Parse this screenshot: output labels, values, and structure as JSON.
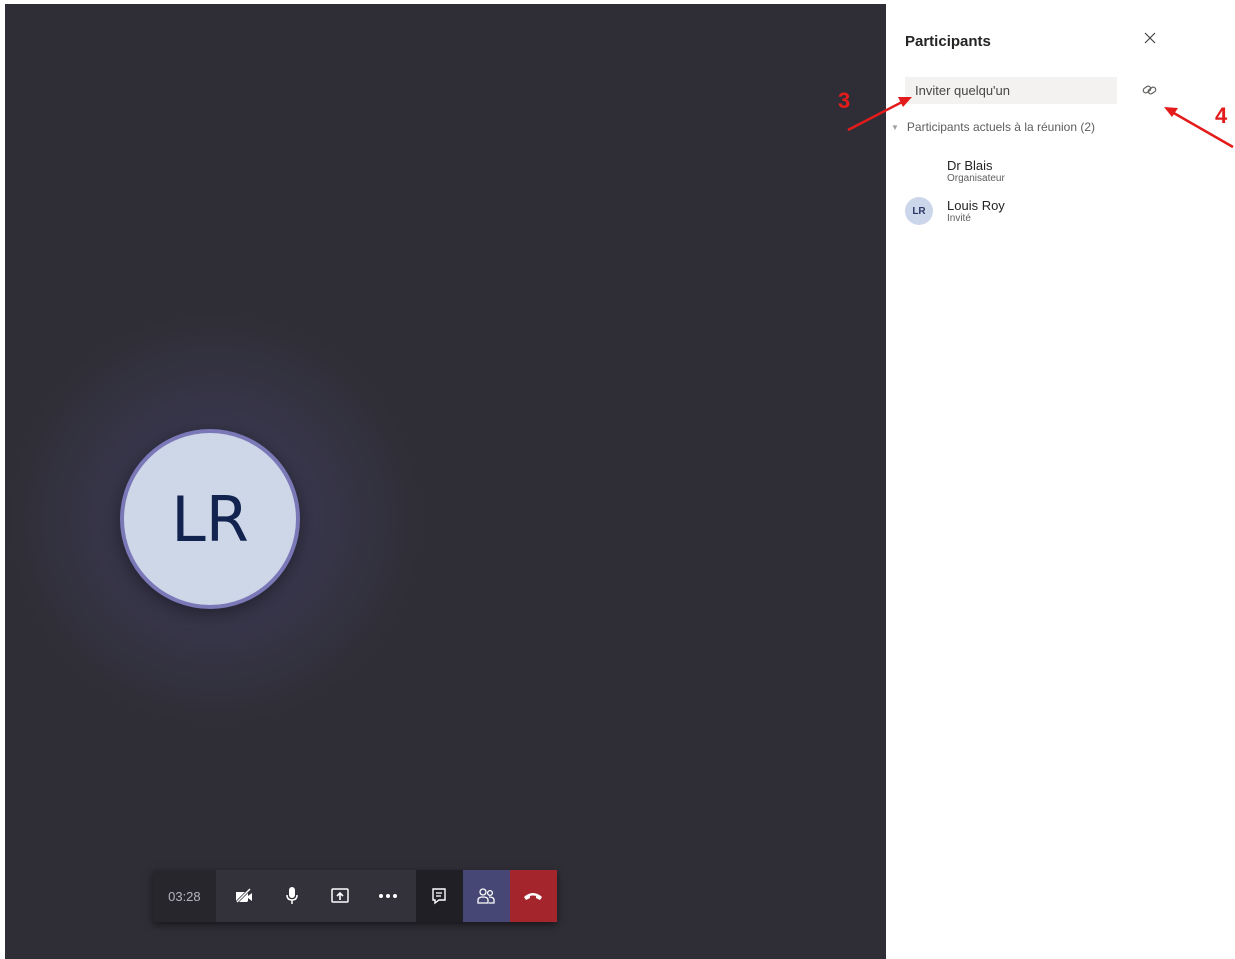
{
  "call": {
    "avatar_initials": "LR",
    "timer": "03:28"
  },
  "controls": {
    "camera_icon": "camera-off-icon",
    "mic_icon": "microphone-icon",
    "share_icon": "share-screen-icon",
    "more_icon": "more-options-icon",
    "chat_icon": "chat-icon",
    "people_icon": "participants-icon",
    "hangup_icon": "hang-up-icon",
    "hangup_color": "#a4262c",
    "people_active_color": "#464775"
  },
  "panel": {
    "title": "Participants",
    "invite_placeholder": "Inviter quelqu'un",
    "section_label": "Participants actuels à la réunion (2)",
    "participants": [
      {
        "initials": "",
        "name": "Dr Blais",
        "role": "Organisateur"
      },
      {
        "initials": "LR",
        "name": "Louis Roy",
        "role": "Invité"
      }
    ]
  },
  "annotations": {
    "label_3": "3",
    "label_4": "4",
    "color": "#e31b1b"
  }
}
